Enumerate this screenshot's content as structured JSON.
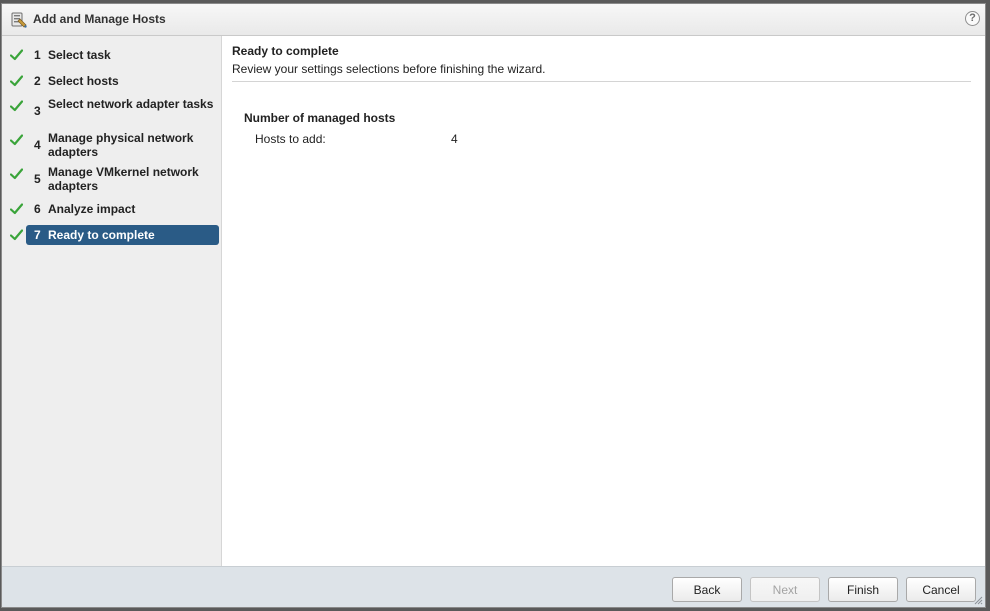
{
  "window": {
    "title": "Add and Manage Hosts",
    "help_label": "?"
  },
  "steps": [
    {
      "num": "1",
      "label": "Select task",
      "state": "complete"
    },
    {
      "num": "2",
      "label": "Select hosts",
      "state": "complete"
    },
    {
      "num": "3",
      "label": "Select network adapter tasks",
      "state": "complete"
    },
    {
      "num": "4",
      "label": "Manage physical network adapters",
      "state": "complete"
    },
    {
      "num": "5",
      "label": "Manage VMkernel network adapters",
      "state": "complete"
    },
    {
      "num": "6",
      "label": "Analyze impact",
      "state": "complete"
    },
    {
      "num": "7",
      "label": "Ready to complete",
      "state": "active"
    }
  ],
  "content": {
    "title": "Ready to complete",
    "subtitle": "Review your settings selections before finishing the wizard.",
    "section_title": "Number of managed hosts",
    "hosts_to_add_label": "Hosts to add:",
    "hosts_to_add_value": "4"
  },
  "footer": {
    "back_label": "Back",
    "next_label": "Next",
    "finish_label": "Finish",
    "cancel_label": "Cancel"
  },
  "colors": {
    "active_step_bg": "#2a5b86",
    "check_green": "#3aa43a",
    "footer_bg": "#dde3e8"
  },
  "icons": {
    "title": "wizard-host-icon",
    "help": "help-icon",
    "step_status": "checkmark-icon"
  }
}
